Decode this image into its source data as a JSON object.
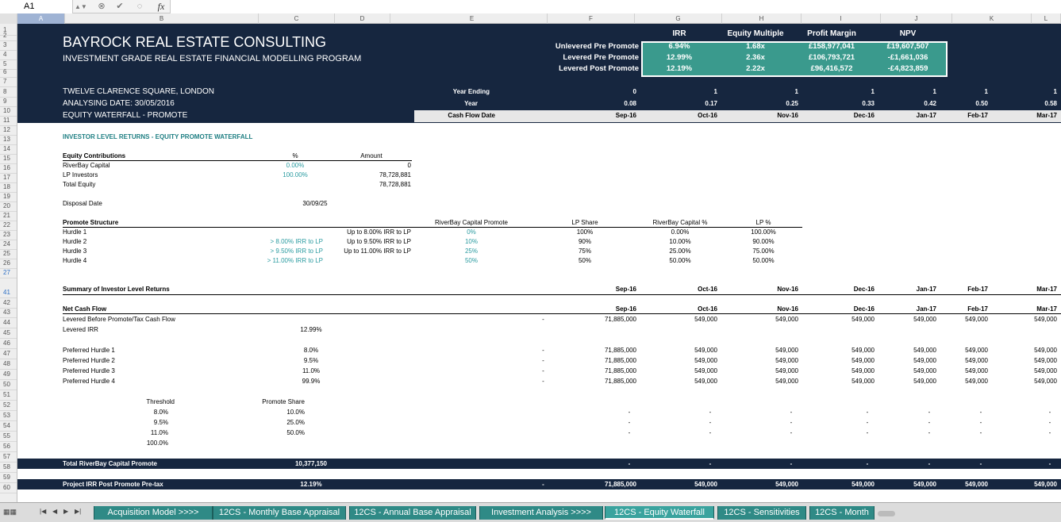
{
  "formula_bar": {
    "cell_ref": "A1",
    "fx": "fx"
  },
  "columns": [
    "A",
    "B",
    "C",
    "D",
    "E",
    "F",
    "G",
    "H",
    "I",
    "J",
    "K",
    "L"
  ],
  "rows": [
    "1",
    "2",
    "3",
    "4",
    "5",
    "6",
    "7",
    "8",
    "9",
    "10",
    "11",
    "12",
    "13",
    "14",
    "15",
    "16",
    "17",
    "18",
    "19",
    "20",
    "21",
    "22",
    "23",
    "24",
    "25",
    "26",
    "27",
    "41",
    "42",
    "43",
    "44",
    "45",
    "46",
    "47",
    "48",
    "49",
    "50",
    "51",
    "52",
    "53",
    "54",
    "55",
    "56",
    "57",
    "58",
    "59",
    "60"
  ],
  "header": {
    "company": "BAYROCK REAL ESTATE CONSULTING",
    "program": "INVESTMENT GRADE REAL ESTATE FINANCIAL MODELLING PROGRAM",
    "address": "TWELVE CLARENCE SQUARE, LONDON",
    "analysing_date": "ANALYSING DATE: 30/05/2016",
    "sheet_title": "EQUITY WATERFALL - PROMOTE"
  },
  "kpi": {
    "headers": [
      "IRR",
      "Equity Multiple",
      "Profit Margin",
      "NPV"
    ],
    "rows": [
      {
        "label": "Unlevered Pre Promote",
        "values": [
          "6.94%",
          "1.68x",
          "£158,977,041",
          "£19,607,507"
        ]
      },
      {
        "label": "Levered Pre Promote",
        "values": [
          "12.99%",
          "2.36x",
          "£106,793,721",
          "-£1,661,036"
        ]
      },
      {
        "label": "Levered Post Promote",
        "values": [
          "12.19%",
          "2.22x",
          "£96,416,572",
          "-£4,823,859"
        ]
      }
    ]
  },
  "timeline": {
    "year_ending_label": "Year Ending",
    "year_label": "Year",
    "cash_flow_date_label": "Cash Flow Date",
    "year_ending": [
      "0",
      "1",
      "1",
      "1",
      "1",
      "1",
      "1"
    ],
    "year": [
      "0.08",
      "0.17",
      "0.25",
      "0.33",
      "0.42",
      "0.50",
      "0.58"
    ],
    "dates": [
      "Sep-16",
      "Oct-16",
      "Nov-16",
      "Dec-16",
      "Jan-17",
      "Feb-17",
      "Mar-17"
    ]
  },
  "section_title": "INVESTOR LEVEL RETURNS - EQUITY PROMOTE WATERFALL",
  "equity": {
    "title": "Equity Contributions",
    "pct_header": "%",
    "amount_header": "Amount",
    "rows": [
      {
        "label": "RiverBay Capital",
        "pct": "0.00%",
        "amount": "0"
      },
      {
        "label": "LP Investors",
        "pct": "100.00%",
        "amount": "78,728,881"
      },
      {
        "label": "Total Equity",
        "pct": "",
        "amount": "78,728,881"
      }
    ],
    "disposal_label": "Disposal Date",
    "disposal_date": "30/09/25"
  },
  "promote": {
    "title": "Promote Structure",
    "headers": [
      "RiverBay Capital Promote",
      "LP Share",
      "RiverBay Capital %",
      "LP %"
    ],
    "rows": [
      {
        "label": "Hurdle 1",
        "cond": "",
        "desc": "Up to 8.00% IRR to LP",
        "promote": "0%",
        "lp_share": "100%",
        "rb_pct": "0.00%",
        "lp_pct": "100.00%"
      },
      {
        "label": "Hurdle 2",
        "cond": "> 8.00% IRR to LP",
        "desc": "Up to 9.50% IRR to LP",
        "promote": "10%",
        "lp_share": "90%",
        "rb_pct": "10.00%",
        "lp_pct": "90.00%"
      },
      {
        "label": "Hurdle 3",
        "cond": "> 9.50% IRR to LP",
        "desc": "Up to 11.00% IRR to LP",
        "promote": "25%",
        "lp_share": "75%",
        "rb_pct": "25.00%",
        "lp_pct": "75.00%"
      },
      {
        "label": "Hurdle 4",
        "cond": "> 11.00% IRR to LP",
        "desc": "",
        "promote": "50%",
        "lp_share": "50%",
        "rb_pct": "50.00%",
        "lp_pct": "50.00%"
      }
    ]
  },
  "summary": {
    "title": "Summary of Investor Level Returns",
    "dates": [
      "Sep-16",
      "Oct-16",
      "Nov-16",
      "Dec-16",
      "Jan-17",
      "Feb-17",
      "Mar-17"
    ]
  },
  "net_cash_flow": {
    "title": "Net Cash Flow",
    "dates": [
      "Sep-16",
      "Oct-16",
      "Nov-16",
      "Dec-16",
      "Jan-17",
      "Feb-17",
      "Mar-17"
    ],
    "before_label": "Levered Before Promote/Tax Cash Flow",
    "before_dash": "-",
    "before_values": [
      "71,885,000",
      "549,000",
      "549,000",
      "549,000",
      "549,000",
      "549,000",
      "549,000"
    ],
    "irr_label": "Levered IRR",
    "irr_value": "12.99%"
  },
  "hurdles": [
    {
      "label": "Preferred Hurdle 1",
      "rate": "8.0%",
      "dash": "-",
      "values": [
        "71,885,000",
        "549,000",
        "549,000",
        "549,000",
        "549,000",
        "549,000",
        "549,000"
      ]
    },
    {
      "label": "Preferred Hurdle 2",
      "rate": "9.5%",
      "dash": "-",
      "values": [
        "71,885,000",
        "549,000",
        "549,000",
        "549,000",
        "549,000",
        "549,000",
        "549,000"
      ]
    },
    {
      "label": "Preferred Hurdle 3",
      "rate": "11.0%",
      "dash": "-",
      "values": [
        "71,885,000",
        "549,000",
        "549,000",
        "549,000",
        "549,000",
        "549,000",
        "549,000"
      ]
    },
    {
      "label": "Preferred Hurdle 4",
      "rate": "99.9%",
      "dash": "-",
      "values": [
        "71,885,000",
        "549,000",
        "549,000",
        "549,000",
        "549,000",
        "549,000",
        "549,000"
      ]
    }
  ],
  "threshold": {
    "threshold_header": "Threshold",
    "share_header": "Promote Share",
    "rows": [
      {
        "threshold": "8.0%",
        "share": "10.0%"
      },
      {
        "threshold": "9.5%",
        "share": "25.0%"
      },
      {
        "threshold": "11.0%",
        "share": "50.0%"
      },
      {
        "threshold": "100.0%",
        "share": ""
      }
    ],
    "dash": "-"
  },
  "total_promote": {
    "label": "Total RiverBay Capital Promote",
    "value": "10,377,150",
    "dash": "-"
  },
  "project_irr": {
    "label": "Project IRR Post Promote Pre-tax",
    "value": "12.19%",
    "dash": "-",
    "values": [
      "71,885,000",
      "549,000",
      "549,000",
      "549,000",
      "549,000",
      "549,000",
      "549,000"
    ]
  },
  "tabs": [
    "Acquisition Model >>>>",
    "12CS - Monthly Base Appraisal",
    "12CS - Annual Base Appraisal",
    "Investment Analysis >>>>",
    "12CS - Equity Waterfall",
    "12CS - Sensitivities",
    "12CS - Month"
  ],
  "colors": {
    "navy": "#16263f",
    "teal": "#3a9a8d",
    "tab": "#2f8a86"
  }
}
